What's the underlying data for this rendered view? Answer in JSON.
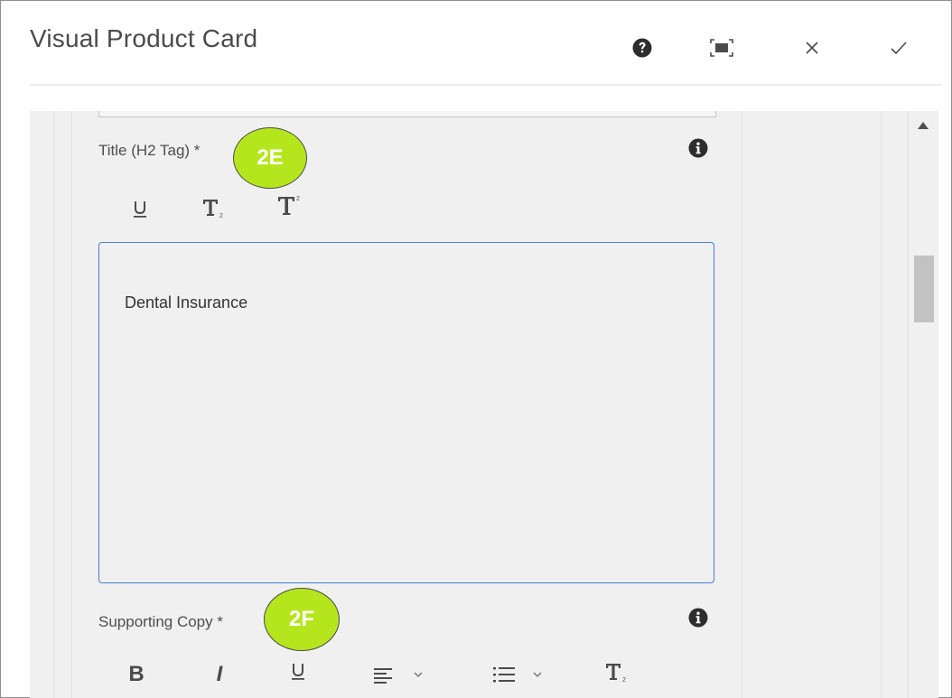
{
  "dialog": {
    "title": "Visual Product Card",
    "help_icon": "help-circle-icon",
    "fullscreen_icon": "fullscreen-icon",
    "close_icon": "close-icon",
    "confirm_icon": "checkmark-icon"
  },
  "title_field": {
    "label": "Title (H2 Tag) *",
    "info_icon": "info-icon",
    "callout": "2E",
    "toolbar": [
      "underline-icon",
      "subscript-icon",
      "superscript-icon"
    ],
    "value": "Dental Insurance"
  },
  "supporting_copy": {
    "label": "Supporting Copy *",
    "info_icon": "info-icon",
    "callout": "2F",
    "toolbar": [
      "bold-icon",
      "italic-icon",
      "underline-icon",
      "align-icon",
      "list-icon",
      "subscript-icon"
    ],
    "bold_label": "B",
    "italic_label": "I"
  },
  "colors": {
    "callout": "#b5e61d",
    "focus_border": "#4a7fd6",
    "panel_bg": "#f0f0f0"
  }
}
